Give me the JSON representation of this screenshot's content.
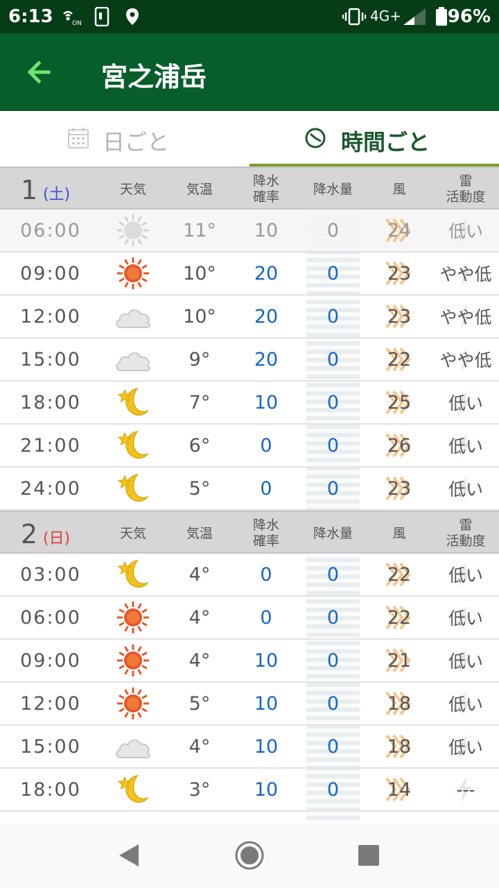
{
  "status_bar": {
    "time": "6:13",
    "network": "4G+",
    "battery": "96%"
  },
  "app_bar": {
    "title": "宮之浦岳"
  },
  "tabs": {
    "daily": "日ごと",
    "hourly": "時間ごと"
  },
  "columns": {
    "weather": "天気",
    "temp": "気温",
    "prob_1": "降水",
    "prob_2": "確率",
    "amount": "降水量",
    "wind": "風",
    "thunder_1": "雷",
    "thunder_2": "活動度"
  },
  "days": [
    {
      "day": "1",
      "dow": "(土)",
      "dow_color": "#3b4fd6",
      "rows": [
        {
          "time": "06:00",
          "weather": "sunny-icon",
          "temp": "11°",
          "prob": "10",
          "amount": "0",
          "wind": "24",
          "thunder": "低い"
        },
        {
          "time": "09:00",
          "weather": "sunny-icon",
          "temp": "10°",
          "prob": "20",
          "amount": "0",
          "wind": "23",
          "thunder": "やや低"
        },
        {
          "time": "12:00",
          "weather": "cloudy-icon",
          "temp": "10°",
          "prob": "20",
          "amount": "0",
          "wind": "23",
          "thunder": "やや低"
        },
        {
          "time": "15:00",
          "weather": "cloudy-icon",
          "temp": "9°",
          "prob": "20",
          "amount": "0",
          "wind": "22",
          "thunder": "やや低"
        },
        {
          "time": "18:00",
          "weather": "moon-icon",
          "temp": "7°",
          "prob": "10",
          "amount": "0",
          "wind": "25",
          "thunder": "低い"
        },
        {
          "time": "21:00",
          "weather": "moon-icon",
          "temp": "6°",
          "prob": "0",
          "amount": "0",
          "wind": "26",
          "thunder": "低い"
        },
        {
          "time": "24:00",
          "weather": "moon-icon",
          "temp": "5°",
          "prob": "0",
          "amount": "0",
          "wind": "23",
          "thunder": "低い"
        }
      ]
    },
    {
      "day": "2",
      "dow": "(日)",
      "dow_color": "#e23b3b",
      "rows": [
        {
          "time": "03:00",
          "weather": "moon-icon",
          "temp": "4°",
          "prob": "0",
          "amount": "0",
          "wind": "22",
          "thunder": "低い"
        },
        {
          "time": "06:00",
          "weather": "sunny-icon",
          "temp": "4°",
          "prob": "0",
          "amount": "0",
          "wind": "22",
          "thunder": "低い"
        },
        {
          "time": "09:00",
          "weather": "sunny-icon",
          "temp": "4°",
          "prob": "10",
          "amount": "0",
          "wind": "21",
          "thunder": "低い"
        },
        {
          "time": "12:00",
          "weather": "sunny-icon",
          "temp": "5°",
          "prob": "10",
          "amount": "0",
          "wind": "18",
          "thunder": "低い"
        },
        {
          "time": "15:00",
          "weather": "cloudy-icon",
          "temp": "4°",
          "prob": "10",
          "amount": "0",
          "wind": "18",
          "thunder": "低い"
        },
        {
          "time": "18:00",
          "weather": "moon-icon",
          "temp": "3°",
          "prob": "10",
          "amount": "0",
          "wind": "14",
          "thunder": "---"
        }
      ]
    }
  ]
}
